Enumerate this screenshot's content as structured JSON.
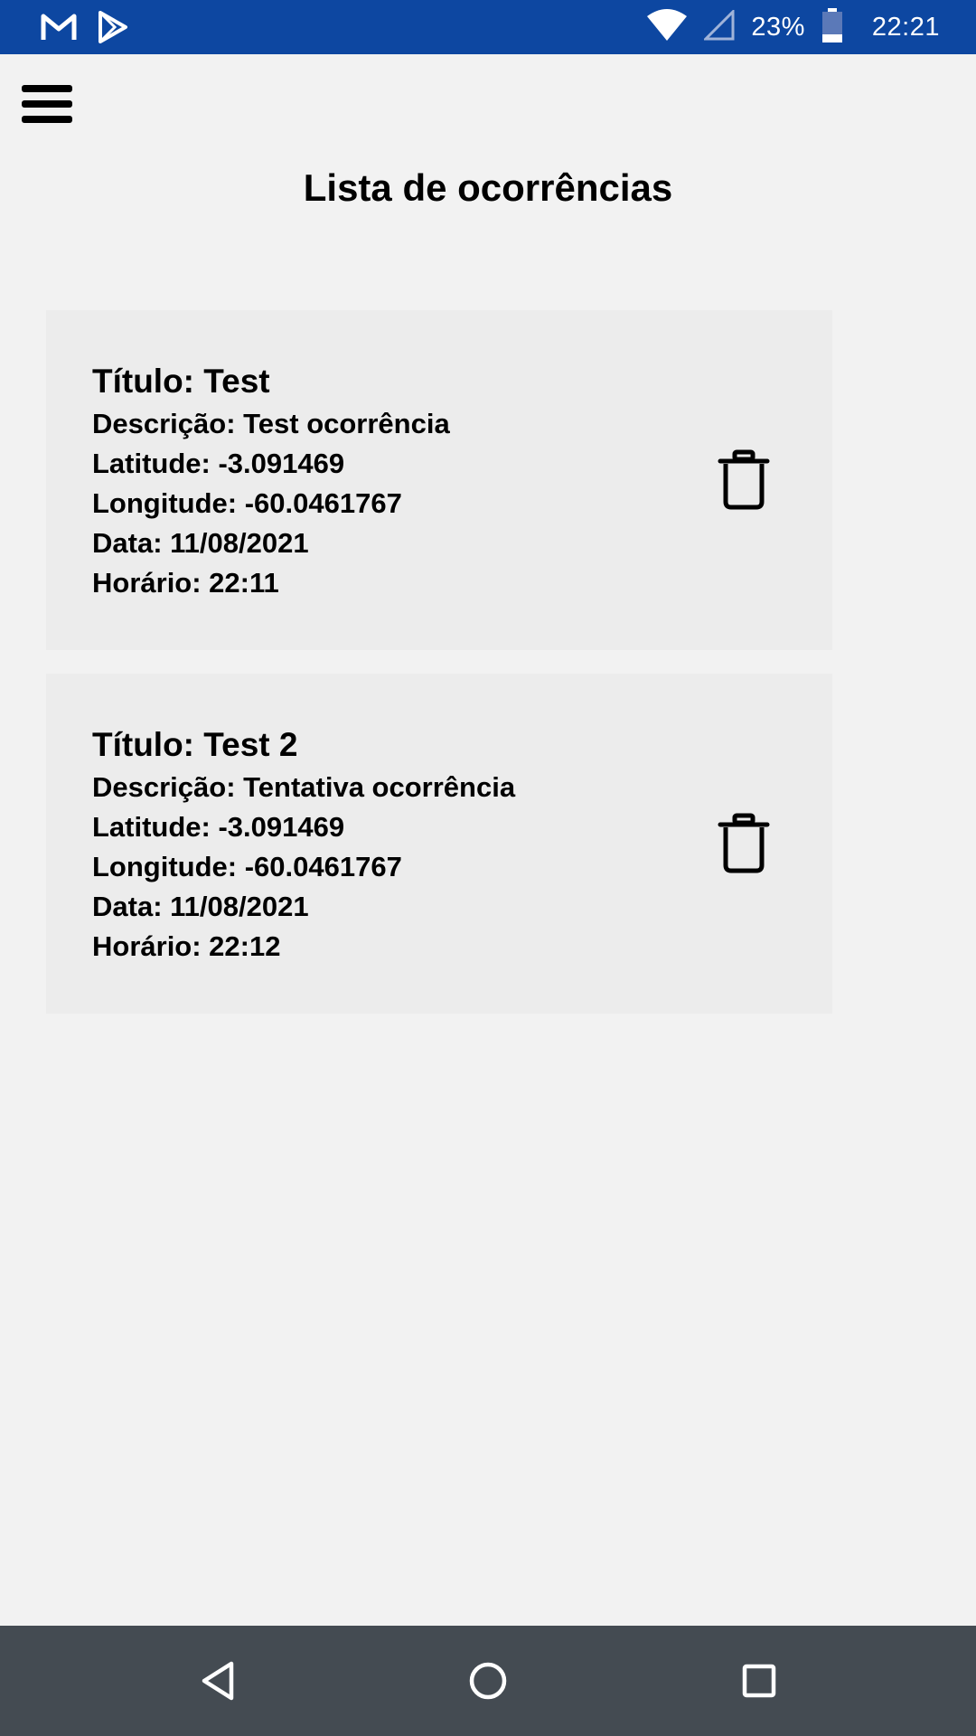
{
  "status_bar": {
    "icons": [
      "gmail-icon",
      "play-store-icon",
      "wifi-icon",
      "cell-signal-icon",
      "battery-icon"
    ],
    "battery_percent": "23%",
    "time": "22:21",
    "background": "#0d47a1"
  },
  "header": {
    "menu_icon": "hamburger-menu-icon",
    "title": "Lista de ocorrências"
  },
  "occurrences": [
    {
      "titulo": "Título: Test",
      "descricao": "Descrição: Test ocorrência",
      "latitude": "Latitude: -3.091469",
      "longitude": "Longitude: -60.0461767",
      "data": "Data: 11/08/2021",
      "horario": "Horário: 22:11",
      "delete_icon": "trash-icon"
    },
    {
      "titulo": "Título: Test 2",
      "descricao": "Descrição: Tentativa ocorrência",
      "latitude": "Latitude: -3.091469",
      "longitude": "Longitude: -60.0461767",
      "data": "Data: 11/08/2021",
      "horario": "Horário: 22:12",
      "delete_icon": "trash-icon"
    }
  ],
  "nav_bar": {
    "buttons": [
      "back-icon",
      "home-icon",
      "recents-icon"
    ],
    "background": "#444b52"
  }
}
